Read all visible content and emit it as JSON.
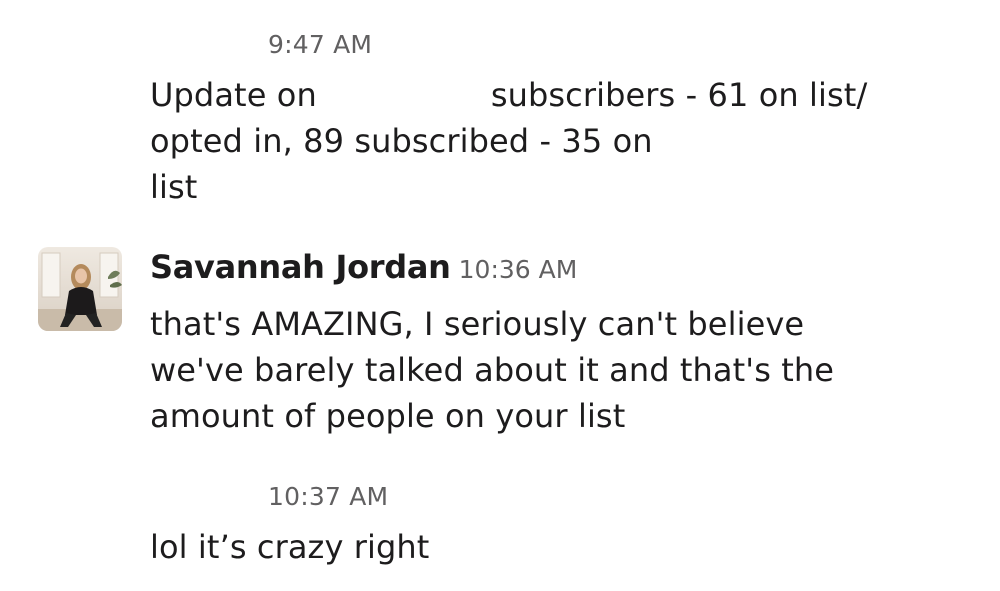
{
  "messages": [
    {
      "time": "9:47 AM",
      "lines": [
        "Update on",
        "subscribers - 61 on list/",
        "opted in, 89 subscribed - 35 on",
        "list"
      ]
    },
    {
      "sender": "Savannah Jordan",
      "avatar_icon": "user-avatar-photo",
      "time": "10:36 AM",
      "lines": [
        "that's AMAZING, I seriously can't believe",
        "we've barely talked about it and that's the",
        "amount of people on your list"
      ]
    },
    {
      "time": "10:37 AM",
      "lines": [
        "lol it’s crazy right"
      ]
    }
  ],
  "colors": {
    "text": "#1d1c1d",
    "timestamp": "#616061",
    "background": "#ffffff"
  }
}
